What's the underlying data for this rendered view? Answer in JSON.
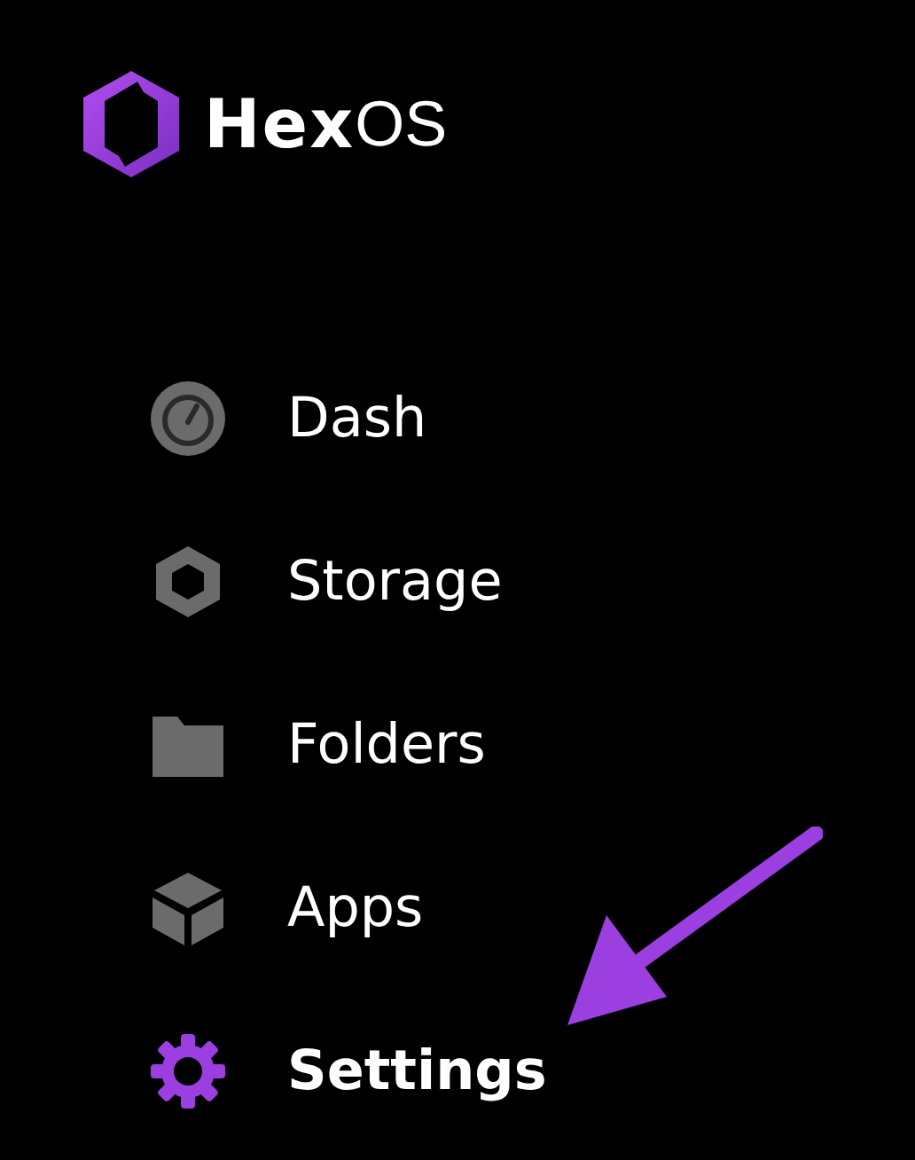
{
  "logo": {
    "bold": "Hex",
    "light": "OS"
  },
  "nav": [
    {
      "label": "Dash",
      "kind": "gauge",
      "selected": false
    },
    {
      "label": "Storage",
      "kind": "hexagon",
      "selected": false
    },
    {
      "label": "Folders",
      "kind": "folder",
      "selected": false
    },
    {
      "label": "Apps",
      "kind": "cube",
      "selected": false
    },
    {
      "label": "Settings",
      "kind": "gear",
      "selected": true
    }
  ]
}
